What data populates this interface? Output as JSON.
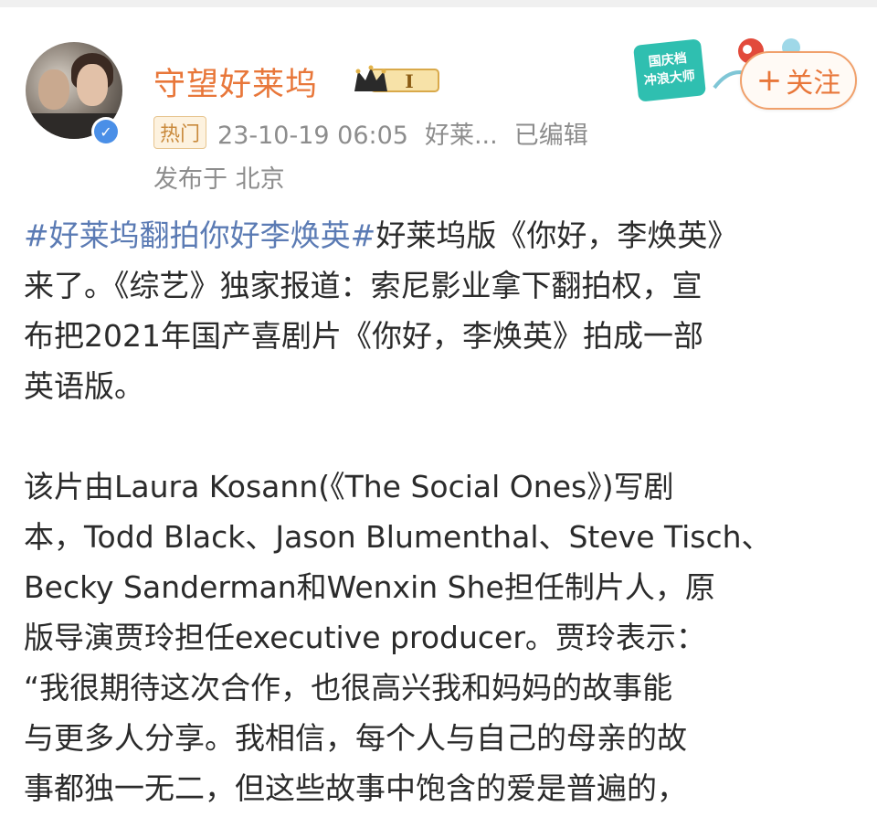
{
  "post": {
    "author": "守望好莱坞",
    "level_badge": "I",
    "tag_hot": "热门",
    "timestamp": "23-10-19 06:05",
    "source": "好莱...",
    "edited": "已编辑",
    "location": "发布于 北京",
    "follow_label": "关注",
    "promo_text": "国庆档冲浪大师"
  },
  "body": {
    "hashtag": "#好莱坞翻拍你好李焕英#",
    "line1_rest": "好莱坞版《你好，李焕英》",
    "line2": "来了。《综艺》独家报道：索尼影业拿下翻拍权，宣",
    "line3": "布把2021年国产喜剧片《你好，李焕英》拍成一部",
    "line4": "英语版。",
    "para2_lines": [
      "该片由Laura Kosann(《The Social Ones》)写剧",
      "本，Todd Black、Jason Blumenthal、Steve Tisch、",
      "Becky Sanderman和Wenxin She担任制片人，原",
      "版导演贾玲担任executive producer。贾玲表示：",
      "“我很期待这次合作，也很高兴我和妈妈的故事能",
      "与更多人分享。我相信，每个人与自己的母亲的故",
      "事都独一无二，但这些故事中饱含的爱是普遍的，"
    ]
  }
}
